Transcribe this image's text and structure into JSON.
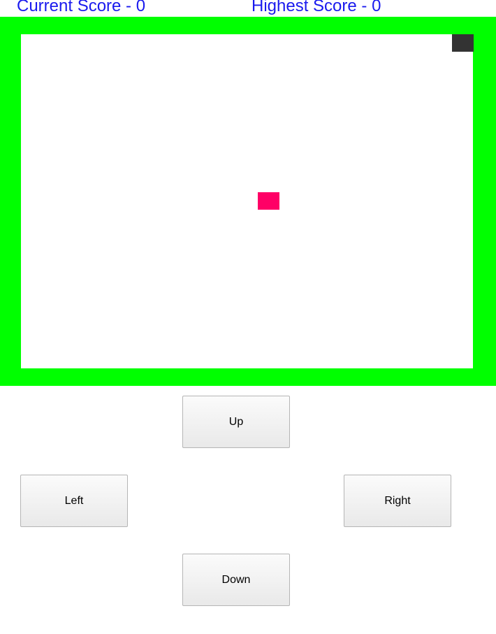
{
  "scores": {
    "current": "Current Score - 0",
    "highest": "Highest Score - 0"
  },
  "board": {
    "border_color": "#00ff00",
    "background_color": "#ffffff",
    "snake_color": "#333333",
    "food_color": "#ff0066"
  },
  "controls": {
    "up": "Up",
    "left": "Left",
    "right": "Right",
    "down": "Down"
  }
}
